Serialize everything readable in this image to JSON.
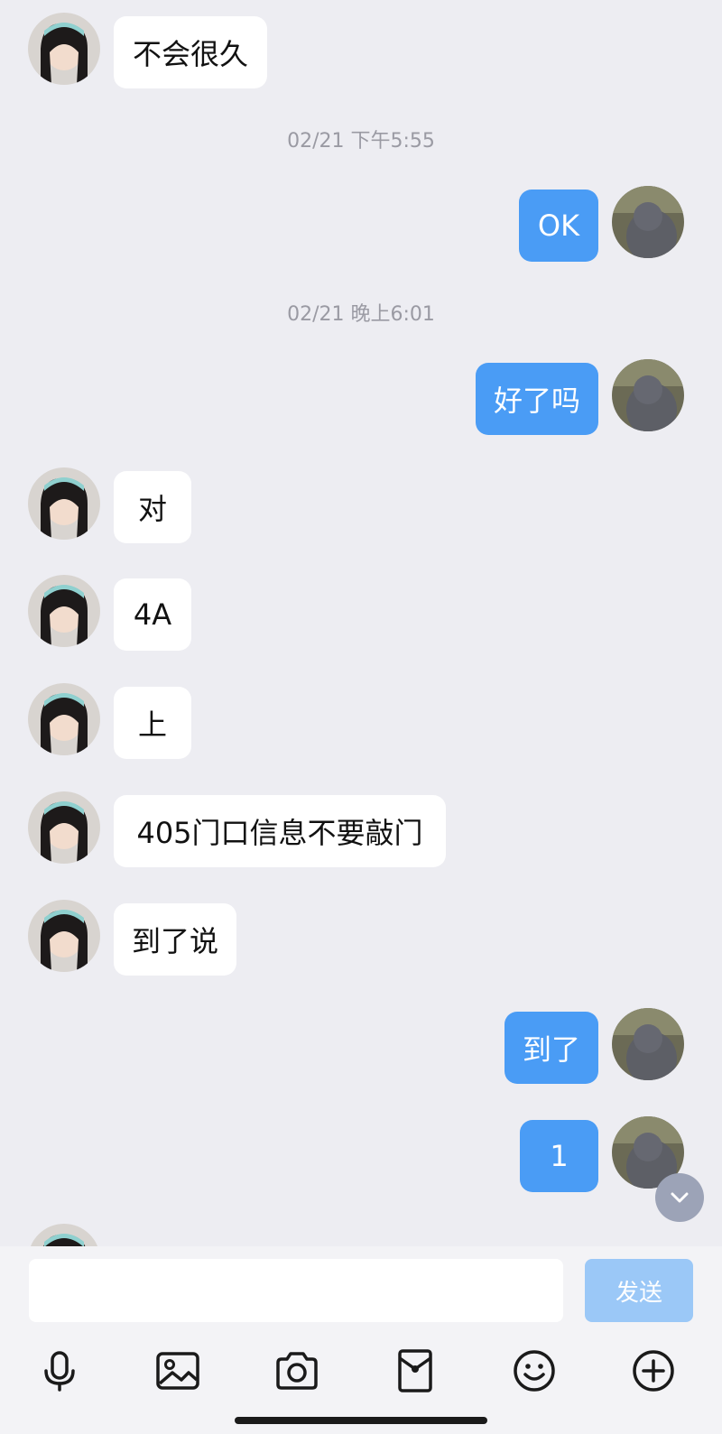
{
  "messages": [
    {
      "side": "in",
      "text": "不会很久"
    },
    {
      "timestamp": "02/21 下午5:55"
    },
    {
      "side": "out",
      "text": "OK"
    },
    {
      "timestamp": "02/21 晚上6:01"
    },
    {
      "side": "out",
      "text": "好了吗"
    },
    {
      "side": "in",
      "text": "对"
    },
    {
      "side": "in",
      "text": "4A"
    },
    {
      "side": "in",
      "text": "上"
    },
    {
      "side": "in",
      "text": "405门口信息不要敲门"
    },
    {
      "side": "in",
      "text": "到了说"
    },
    {
      "side": "out",
      "text": "到了"
    },
    {
      "side": "out",
      "text": "1"
    }
  ],
  "input": {
    "value": "",
    "placeholder": ""
  },
  "send_label": "发送",
  "toolbar": [
    "microphone-icon",
    "image-icon",
    "camera-icon",
    "red-packet-icon",
    "emoji-icon",
    "add-icon"
  ],
  "colors": {
    "background": "#ededf2",
    "outgoing_bubble": "#4a9cf5",
    "incoming_bubble": "#ffffff",
    "send_button": "#9bc8f7"
  }
}
